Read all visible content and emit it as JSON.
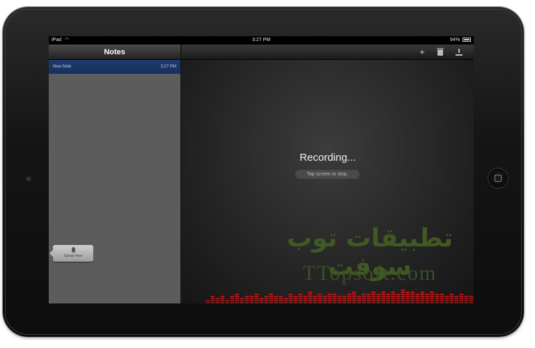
{
  "status_bar": {
    "carrier": "iPad",
    "time": "3:27 PM",
    "battery": "94%"
  },
  "sidebar": {
    "title": "Notes",
    "notes": [
      {
        "title": "New Note",
        "date": "3:27 PM"
      }
    ],
    "speak_here_label": "Speak Here"
  },
  "toolbar": {
    "add_icon": "plus-icon",
    "delete_icon": "trash-icon",
    "download_icon": "download-icon"
  },
  "main": {
    "status_text": "Recording...",
    "hint": "Tap screen to stop."
  },
  "watermark": {
    "arabic": "تطبيقات توب سوفت",
    "latin": "TTopsoft.com"
  },
  "level_meter": {
    "levels": [
      0.3,
      0.5,
      0.4,
      0.6,
      0.35,
      0.55,
      0.7,
      0.45,
      0.6,
      0.5,
      0.65,
      0.4,
      0.55,
      0.75,
      0.5,
      0.6,
      0.45,
      0.7,
      0.55,
      0.65,
      0.5,
      0.8,
      0.6,
      0.7,
      0.55,
      0.65,
      0.75,
      0.5,
      0.6,
      0.7,
      0.85,
      0.6,
      0.75,
      0.65,
      0.8,
      0.7,
      0.9,
      0.75,
      0.85,
      0.7,
      0.95,
      0.8,
      0.85,
      0.75,
      0.9,
      0.7,
      0.8,
      0.65,
      0.75,
      0.6,
      0.7,
      0.55,
      0.65,
      0.5,
      0.6
    ],
    "color": "#e01414"
  }
}
